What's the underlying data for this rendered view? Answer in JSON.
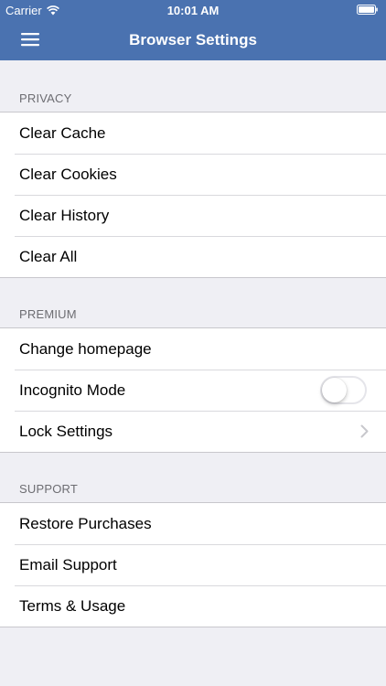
{
  "status_bar": {
    "carrier": "Carrier",
    "time": "10:01 AM"
  },
  "nav": {
    "title": "Browser Settings",
    "menu_icon": "hamburger-menu-icon"
  },
  "colors": {
    "nav_background": "#4a72b0",
    "page_background": "#efeff4"
  },
  "sections": [
    {
      "header": "PRIVACY",
      "items": [
        {
          "label": "Clear Cache"
        },
        {
          "label": "Clear Cookies"
        },
        {
          "label": "Clear History"
        },
        {
          "label": "Clear All"
        }
      ]
    },
    {
      "header": "PREMIUM",
      "items": [
        {
          "label": "Change homepage"
        },
        {
          "label": "Incognito Mode",
          "toggle": false
        },
        {
          "label": "Lock Settings",
          "accessory": "chevron-right-icon"
        }
      ]
    },
    {
      "header": "SUPPORT",
      "items": [
        {
          "label": "Restore Purchases"
        },
        {
          "label": "Email Support"
        },
        {
          "label": "Terms & Usage"
        }
      ]
    }
  ]
}
